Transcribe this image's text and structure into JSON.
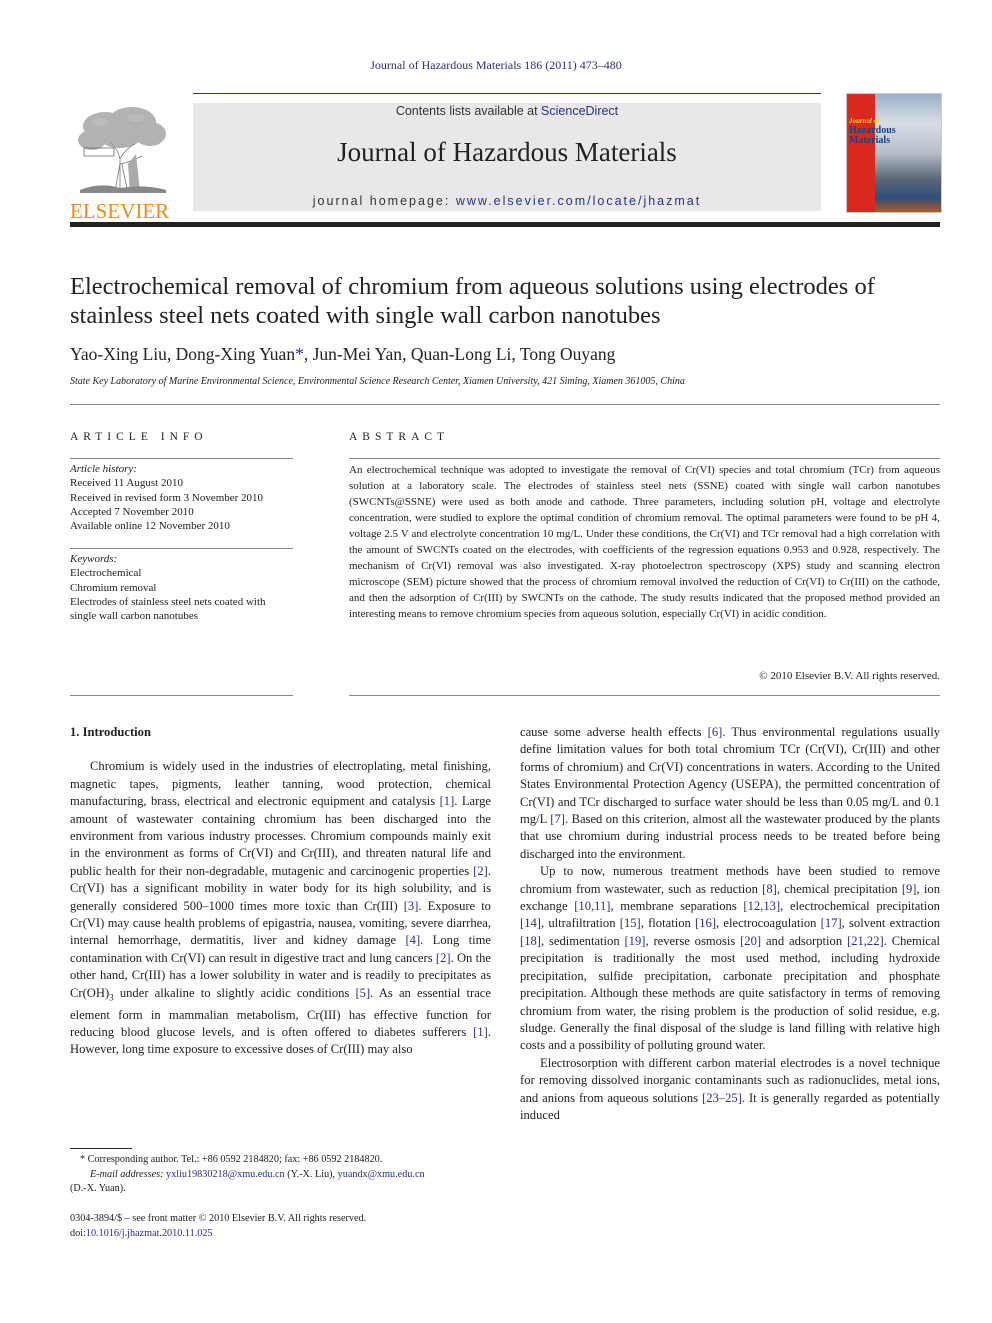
{
  "running_head": "Journal of Hazardous Materials 186 (2011) 473–480",
  "publisher": {
    "logo_text": "ELSEVIER",
    "logo_icon": "elsevier-tree-icon",
    "brand_color": "#f08a1c"
  },
  "banner": {
    "contents_prefix": "Contents lists available at ",
    "contents_link": "ScienceDirect",
    "journal_title": "Journal of Hazardous Materials",
    "homepage_prefix": "journal homepage: ",
    "homepage_link": "www.elsevier.com/locate/jhazmat",
    "link_color": "#2a2f8a"
  },
  "cover": {
    "line1": "Journal of",
    "line2": "Hazardous",
    "line3": "Materials",
    "accent_color": "#d9281e"
  },
  "article": {
    "title": "Electrochemical removal of chromium from aqueous solutions using electrodes of stainless steel nets coated with single wall carbon nanotubes",
    "authors": [
      {
        "name": "Yao-Xing Liu",
        "sep": ", "
      },
      {
        "name": "Dong-Xing Yuan",
        "mark": "*",
        "sep": ", "
      },
      {
        "name": "Jun-Mei Yan",
        "sep": ", "
      },
      {
        "name": "Quan-Long Li",
        "sep": ", "
      },
      {
        "name": "Tong Ouyang",
        "sep": ""
      }
    ],
    "affiliation": "State Key Laboratory of Marine Environmental Science, Environmental Science Research Center, Xiamen University, 421 Siming, Xiamen 361005, China"
  },
  "article_info": {
    "heading": "ARTICLE INFO",
    "history_label": "Article history:",
    "history": [
      "Received 11 August 2010",
      "Received in revised form 3 November 2010",
      "Accepted 7 November 2010",
      "Available online 12 November 2010"
    ],
    "keywords_label": "Keywords:",
    "keywords": [
      "Electrochemical",
      "Chromium removal",
      "Electrodes of stainless steel nets coated with single wall carbon nanotubes"
    ]
  },
  "abstract": {
    "heading": "ABSTRACT",
    "text": "An electrochemical technique was adopted to investigate the removal of Cr(VI) species and total chromium (TCr) from aqueous solution at a laboratory scale. The electrodes of stainless steel nets (SSNE) coated with single wall carbon nanotubes (SWCNTs@SSNE) were used as both anode and cathode. Three parameters, including solution pH, voltage and electrolyte concentration, were studied to explore the optimal condition of chromium removal. The optimal parameters were found to be pH 4, voltage 2.5 V and electrolyte concentration 10 mg/L. Under these conditions, the Cr(VI) and TCr removal had a high correlation with the amount of SWCNTs coated on the electrodes, with coefficients of the regression equations 0.953 and 0.928, respectively. The mechanism of Cr(VI) removal was also investigated. X-ray photoelectron spectroscopy (XPS) study and scanning electron microscope (SEM) picture showed that the process of chromium removal involved the reduction of Cr(VI) to Cr(III) on the cathode, and then the adsorption of Cr(III) by SWCNTs on the cathode. The study results indicated that the proposed method provided an interesting means to remove chromium species from aqueous solution, especially Cr(VI) in acidic condition.",
    "copyright": "© 2010 Elsevier B.V. All rights reserved."
  },
  "intro": {
    "heading": "1.  Introduction",
    "left_paragraphs": [
      [
        {
          "t": "Chromium is widely used in the industries of electroplating, metal finishing, magnetic tapes, pigments, leather tanning, wood protection, chemical manufacturing, brass, electrical and electronic equipment and catalysis "
        },
        {
          "r": "[1]"
        },
        {
          "t": ". Large amount of wastewater containing chromium has been discharged into the environment from various industry processes. Chromium compounds mainly exit in the environment as forms of Cr(VI) and Cr(III), and threaten natural life and public health for their non-degradable, mutagenic and carcinogenic properties "
        },
        {
          "r": "[2]"
        },
        {
          "t": ". Cr(VI) has a significant mobility in water body for its high solubility, and is generally considered 500–1000 times more toxic than Cr(III) "
        },
        {
          "r": "[3]"
        },
        {
          "t": ". Exposure to Cr(VI) may cause health problems of epigastria, nausea, vomiting, severe diarrhea, internal hemorrhage, dermatitis, liver and kidney damage "
        },
        {
          "r": "[4]"
        },
        {
          "t": ". Long time contamination with Cr(VI) can result in digestive tract and lung cancers "
        },
        {
          "r": "[2]"
        },
        {
          "t": ". On the other hand, Cr(III) has a lower solubility in water and is readily to precipitates as Cr(OH)"
        },
        {
          "sub": "3"
        },
        {
          "t": " under alkaline to slightly acidic conditions "
        },
        {
          "r": "[5]"
        },
        {
          "t": ". As an essential trace element form in mammalian metabolism, Cr(III) has effective function for reducing blood glucose levels, and is often offered to diabetes sufferers "
        },
        {
          "r": "[1]"
        },
        {
          "t": ". However, long time exposure to excessive doses of Cr(III) may also"
        }
      ]
    ],
    "right_paragraphs": [
      {
        "indent": false,
        "runs": [
          {
            "t": "cause some adverse health effects "
          },
          {
            "r": "[6]"
          },
          {
            "t": ". Thus environmental regulations usually define limitation values for both total chromium TCr (Cr(VI), Cr(III) and other forms of chromium) and Cr(VI) concentrations in waters. According to the United States Environmental Protection Agency (USEPA), the permitted concentration of Cr(VI) and TCr discharged to surface water should be less than 0.05 mg/L and 0.1 mg/L "
          },
          {
            "r": "[7]"
          },
          {
            "t": ". Based on this criterion, almost all the wastewater produced by the plants that use chromium during industrial process needs to be treated before being discharged into the environment."
          }
        ]
      },
      {
        "indent": true,
        "runs": [
          {
            "t": "Up to now, numerous treatment methods have been studied to remove chromium from wastewater, such as reduction "
          },
          {
            "r": "[8]"
          },
          {
            "t": ", chemical precipitation "
          },
          {
            "r": "[9]"
          },
          {
            "t": ", ion exchange "
          },
          {
            "r": "[10,11]"
          },
          {
            "t": ", membrane separations "
          },
          {
            "r": "[12,13]"
          },
          {
            "t": ", electrochemical precipitation "
          },
          {
            "r": "[14]"
          },
          {
            "t": ", ultrafiltration "
          },
          {
            "r": "[15]"
          },
          {
            "t": ", flotation "
          },
          {
            "r": "[16]"
          },
          {
            "t": ", electrocoagulation "
          },
          {
            "r": "[17]"
          },
          {
            "t": ", solvent extraction "
          },
          {
            "r": "[18]"
          },
          {
            "t": ", sedimentation "
          },
          {
            "r": "[19]"
          },
          {
            "t": ", reverse osmosis "
          },
          {
            "r": "[20]"
          },
          {
            "t": " and adsorption "
          },
          {
            "r": "[21,22]"
          },
          {
            "t": ". Chemical precipitation is traditionally the most used method, including hydroxide precipitation, sulfide precipitation, carbonate precipitation and phosphate precipitation. Although these methods are quite satisfactory in terms of removing chromium from water, the rising problem is the production of solid residue, e.g. sludge. Generally the final disposal of the sludge is land filling with relative high costs and a possibility of polluting ground water."
          }
        ]
      },
      {
        "indent": true,
        "runs": [
          {
            "t": "Electrosorption with different carbon material electrodes is a novel technique for removing dissolved inorganic contaminants such as radionuclides, metal ions, and anions from aqueous solutions "
          },
          {
            "r": "[23–25]"
          },
          {
            "t": ". It is generally regarded as potentially induced"
          }
        ]
      }
    ]
  },
  "footnote": {
    "mark": "*",
    "corresponding": "Corresponding author. Tel.: +86 0592 2184820; fax: +86 0592 2184820.",
    "email_label": "E-mail addresses:",
    "email1": "yxliu19830218@xmu.edu.cn",
    "email1_owner": " (Y.-X. Liu), ",
    "email2": "yuandx@xmu.edu.cn",
    "email2_owner": "(D.-X. Yuan)."
  },
  "front_matter": {
    "issn_line": "0304-3894/$ – see front matter © 2010 Elsevier B.V. All rights reserved.",
    "doi_prefix": "doi:",
    "doi": "10.1016/j.jhazmat.2010.11.025"
  }
}
